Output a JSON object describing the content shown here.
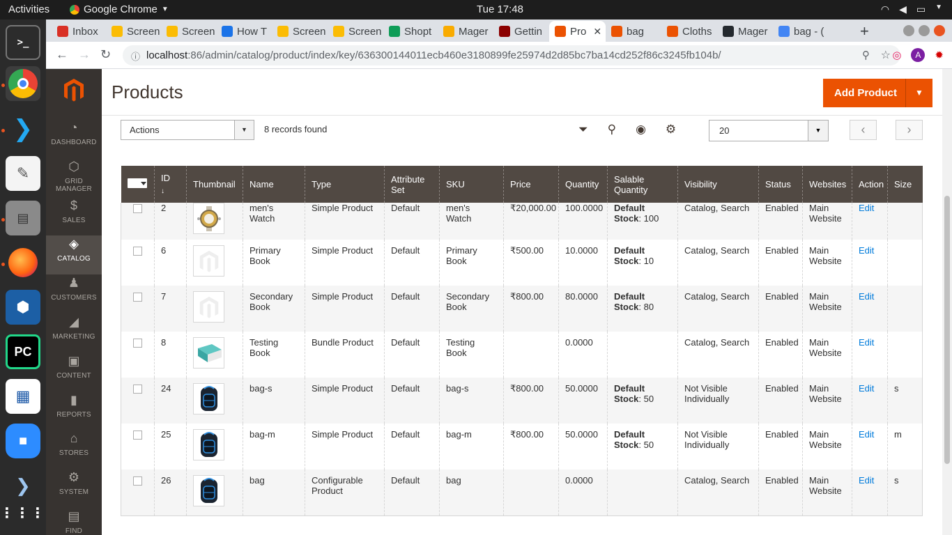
{
  "os": {
    "activities": "Activities",
    "app_menu": "Google Chrome",
    "clock": "Tue 17:48"
  },
  "browser": {
    "tabs": [
      {
        "label": "Inbox",
        "color": "#d93025"
      },
      {
        "label": "Screen",
        "color": "#fbbc04"
      },
      {
        "label": "Screen",
        "color": "#fbbc04"
      },
      {
        "label": "How T",
        "color": "#1a73e8"
      },
      {
        "label": "Screen",
        "color": "#fbbc04"
      },
      {
        "label": "Screen",
        "color": "#fbbc04"
      },
      {
        "label": "Shopt",
        "color": "#0f9d58"
      },
      {
        "label": "Mager",
        "color": "#f9ab00"
      },
      {
        "label": "Gettin",
        "color": "#8b0000"
      },
      {
        "label": "Pro",
        "color": "#eb5202",
        "active": true
      },
      {
        "label": "bag",
        "color": "#eb5202"
      },
      {
        "label": "Cloths",
        "color": "#eb5202"
      },
      {
        "label": "Mager",
        "color": "#24292e"
      },
      {
        "label": "bag - (",
        "color": "#4285f4"
      }
    ],
    "url_host": "localhost",
    "url_path": ":86/admin/catalog/product/index/key/636300144011ecb460e3180899fe25974d2d85bc7ba14cd252f86c3245fb104b/",
    "profile_initial": "A"
  },
  "admin_nav": [
    {
      "label": "DASHBOARD",
      "icon": "dashboard-icon",
      "glyph": "◔"
    },
    {
      "label": "GRID MANAGER",
      "icon": "hexagon-icon",
      "glyph": "⬡"
    },
    {
      "label": "SALES",
      "icon": "dollar-icon",
      "glyph": "$"
    },
    {
      "label": "CATALOG",
      "icon": "cube-icon",
      "glyph": "◈",
      "active": true
    },
    {
      "label": "CUSTOMERS",
      "icon": "person-icon",
      "glyph": "♟"
    },
    {
      "label": "MARKETING",
      "icon": "megaphone-icon",
      "glyph": "◢"
    },
    {
      "label": "CONTENT",
      "icon": "layout-icon",
      "glyph": "▣"
    },
    {
      "label": "REPORTS",
      "icon": "bar-chart-icon",
      "glyph": "▮"
    },
    {
      "label": "STORES",
      "icon": "store-icon",
      "glyph": "⌂"
    },
    {
      "label": "SYSTEM",
      "icon": "gear-icon",
      "glyph": "⚙"
    },
    {
      "label": "FIND PARTNERS",
      "icon": "box-icon",
      "glyph": "▤"
    }
  ],
  "page": {
    "title": "Products",
    "add_button": "Add Product"
  },
  "toolbar": {
    "actions_label": "Actions",
    "records": "8 records found",
    "per_page": "20"
  },
  "grid": {
    "columns": [
      "ID",
      "Thumbnail",
      "Name",
      "Type",
      "Attribute Set",
      "SKU",
      "Price",
      "Quantity",
      "Salable Quantity",
      "Visibility",
      "Status",
      "Websites",
      "Action",
      "Size"
    ],
    "stock_prefix": "Default Stock",
    "rows": [
      {
        "id": "2",
        "thumb": "watch",
        "name": "men's Watch",
        "type": "Simple Product",
        "set": "Default",
        "sku": "men's Watch",
        "price": "₹20,000.00",
        "qty": "100.0000",
        "salable": ": 100",
        "visibility": "Catalog, Search",
        "status": "Enabled",
        "websites": "Main Website",
        "action": "Edit",
        "size": ""
      },
      {
        "id": "6",
        "thumb": "placeholder",
        "name": "Primary Book",
        "type": "Simple Product",
        "set": "Default",
        "sku": "Primary Book",
        "price": "₹500.00",
        "qty": "10.0000",
        "salable": ": 10",
        "visibility": "Catalog, Search",
        "status": "Enabled",
        "websites": "Main Website",
        "action": "Edit",
        "size": ""
      },
      {
        "id": "7",
        "thumb": "placeholder",
        "name": "Secondary Book",
        "type": "Simple Product",
        "set": "Default",
        "sku": "Secondary Book",
        "price": "₹800.00",
        "qty": "80.0000",
        "salable": ": 80",
        "visibility": "Catalog, Search",
        "status": "Enabled",
        "websites": "Main Website",
        "action": "Edit",
        "size": ""
      },
      {
        "id": "8",
        "thumb": "book",
        "name": "Testing Book",
        "type": "Bundle Product",
        "set": "Default",
        "sku": "Testing Book",
        "price": "",
        "qty": "0.0000",
        "salable": "",
        "visibility": "Catalog, Search",
        "status": "Enabled",
        "websites": "Main Website",
        "action": "Edit",
        "size": ""
      },
      {
        "id": "24",
        "thumb": "bag",
        "name": "bag-s",
        "type": "Simple Product",
        "set": "Default",
        "sku": "bag-s",
        "price": "₹800.00",
        "qty": "50.0000",
        "salable": ": 50",
        "visibility": "Not Visible Individually",
        "status": "Enabled",
        "websites": "Main Website",
        "action": "Edit",
        "size": "s"
      },
      {
        "id": "25",
        "thumb": "bag",
        "name": "bag-m",
        "type": "Simple Product",
        "set": "Default",
        "sku": "bag-m",
        "price": "₹800.00",
        "qty": "50.0000",
        "salable": ": 50",
        "visibility": "Not Visible Individually",
        "status": "Enabled",
        "websites": "Main Website",
        "action": "Edit",
        "size": "m"
      },
      {
        "id": "26",
        "thumb": "bag",
        "name": "bag",
        "type": "Configurable Product",
        "set": "Default",
        "sku": "bag",
        "price": "",
        "qty": "0.0000",
        "salable": "",
        "visibility": "Catalog, Search",
        "status": "Enabled",
        "websites": "Main Website",
        "action": "Edit",
        "size": "s"
      }
    ]
  }
}
